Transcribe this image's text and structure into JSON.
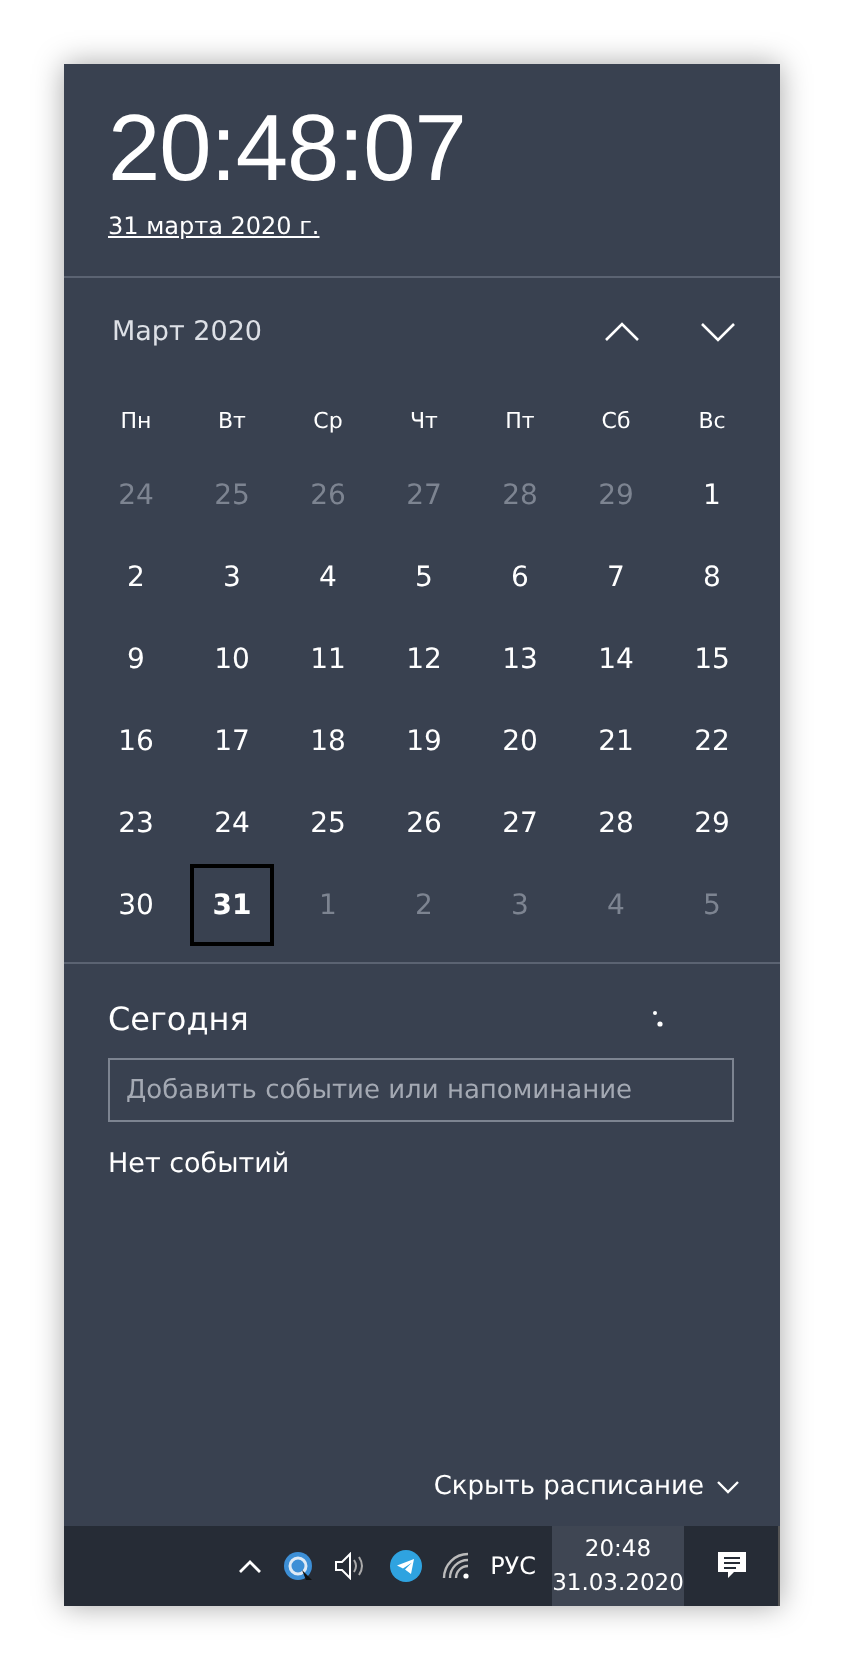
{
  "clock": {
    "time": "20:48:07",
    "date": "31 марта 2020 г."
  },
  "calendar": {
    "month": "Март 2020",
    "weekdays": [
      "Пн",
      "Вт",
      "Ср",
      "Чт",
      "Пт",
      "Сб",
      "Вс"
    ],
    "days": [
      {
        "label": "24",
        "in_month": false,
        "selected": false
      },
      {
        "label": "25",
        "in_month": false,
        "selected": false
      },
      {
        "label": "26",
        "in_month": false,
        "selected": false
      },
      {
        "label": "27",
        "in_month": false,
        "selected": false
      },
      {
        "label": "28",
        "in_month": false,
        "selected": false
      },
      {
        "label": "29",
        "in_month": false,
        "selected": false
      },
      {
        "label": "1",
        "in_month": true,
        "selected": false
      },
      {
        "label": "2",
        "in_month": true,
        "selected": false
      },
      {
        "label": "3",
        "in_month": true,
        "selected": false
      },
      {
        "label": "4",
        "in_month": true,
        "selected": false
      },
      {
        "label": "5",
        "in_month": true,
        "selected": false
      },
      {
        "label": "6",
        "in_month": true,
        "selected": false
      },
      {
        "label": "7",
        "in_month": true,
        "selected": false
      },
      {
        "label": "8",
        "in_month": true,
        "selected": false
      },
      {
        "label": "9",
        "in_month": true,
        "selected": false
      },
      {
        "label": "10",
        "in_month": true,
        "selected": false
      },
      {
        "label": "11",
        "in_month": true,
        "selected": false
      },
      {
        "label": "12",
        "in_month": true,
        "selected": false
      },
      {
        "label": "13",
        "in_month": true,
        "selected": false
      },
      {
        "label": "14",
        "in_month": true,
        "selected": false
      },
      {
        "label": "15",
        "in_month": true,
        "selected": false
      },
      {
        "label": "16",
        "in_month": true,
        "selected": false
      },
      {
        "label": "17",
        "in_month": true,
        "selected": false
      },
      {
        "label": "18",
        "in_month": true,
        "selected": false
      },
      {
        "label": "19",
        "in_month": true,
        "selected": false
      },
      {
        "label": "20",
        "in_month": true,
        "selected": false
      },
      {
        "label": "21",
        "in_month": true,
        "selected": false
      },
      {
        "label": "22",
        "in_month": true,
        "selected": false
      },
      {
        "label": "23",
        "in_month": true,
        "selected": false
      },
      {
        "label": "24",
        "in_month": true,
        "selected": false
      },
      {
        "label": "25",
        "in_month": true,
        "selected": false
      },
      {
        "label": "26",
        "in_month": true,
        "selected": false
      },
      {
        "label": "27",
        "in_month": true,
        "selected": false
      },
      {
        "label": "28",
        "in_month": true,
        "selected": false
      },
      {
        "label": "29",
        "in_month": true,
        "selected": false
      },
      {
        "label": "30",
        "in_month": true,
        "selected": false
      },
      {
        "label": "31",
        "in_month": true,
        "selected": true
      },
      {
        "label": "1",
        "in_month": false,
        "selected": false
      },
      {
        "label": "2",
        "in_month": false,
        "selected": false
      },
      {
        "label": "3",
        "in_month": false,
        "selected": false
      },
      {
        "label": "4",
        "in_month": false,
        "selected": false
      },
      {
        "label": "5",
        "in_month": false,
        "selected": false
      }
    ]
  },
  "agenda": {
    "title": "Сегодня",
    "placeholder": "Добавить событие или напоминание",
    "empty_text": "Нет событий",
    "toggle": "Скрыть расписание"
  },
  "taskbar": {
    "language": "РУС",
    "time": "20:48",
    "date": "31.03.2020"
  }
}
